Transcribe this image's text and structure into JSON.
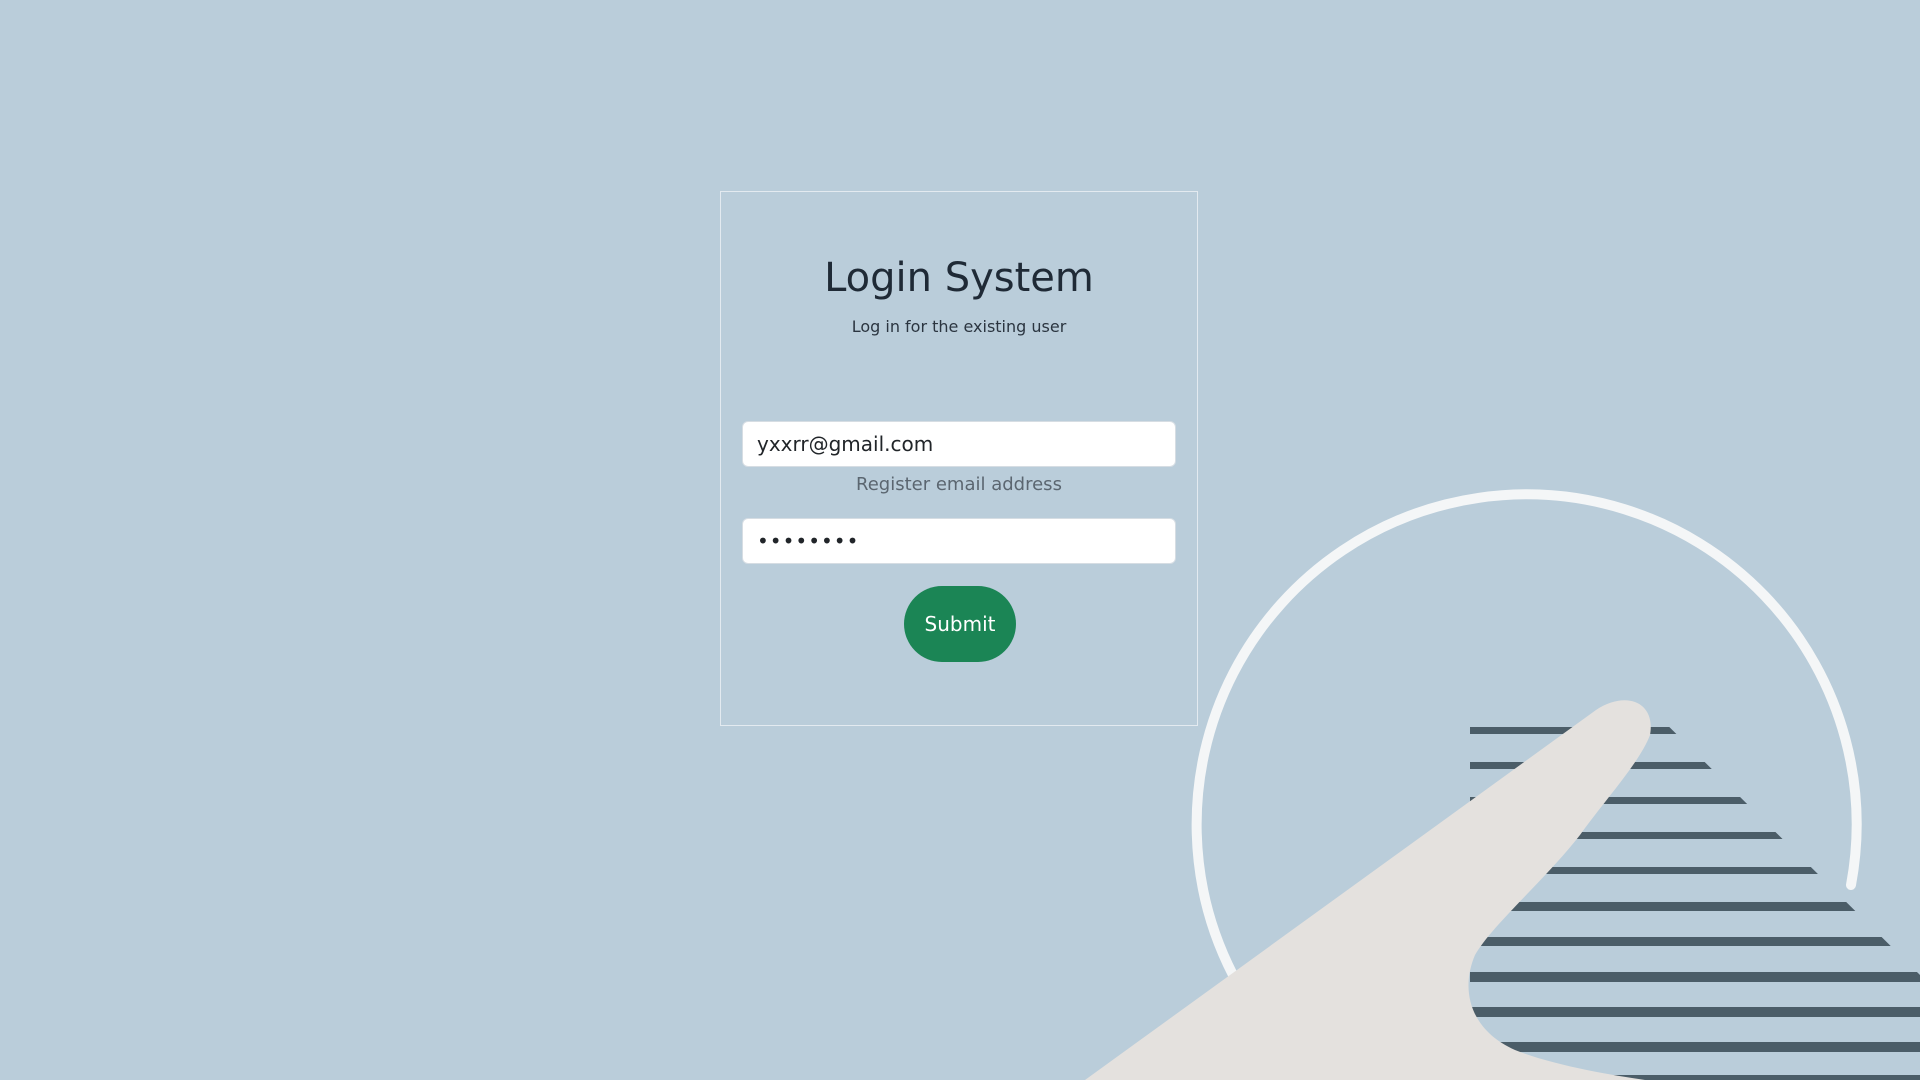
{
  "login": {
    "title": "Login System",
    "subtitle": "Log in for the existing user",
    "email_value": "yxxrr@gmail.com",
    "email_help": "Register email address",
    "password_value": "password",
    "submit_label": "Submit"
  },
  "colors": {
    "background": "#bacdda",
    "submit_button": "#1b8555",
    "illustration_ring": "#f4f6f7",
    "illustration_hand": "#e4e1de",
    "illustration_stripes": "#4b5d68"
  },
  "illustration": {
    "icon": "hand-pointing-illustration"
  }
}
